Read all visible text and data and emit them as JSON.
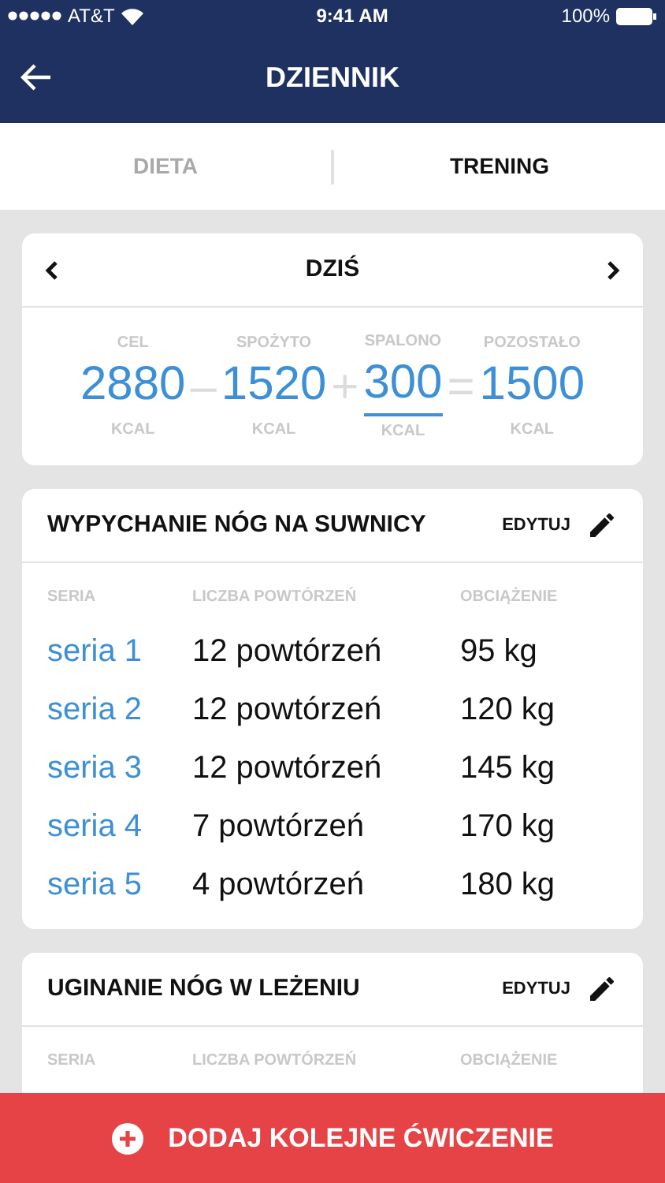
{
  "status_bar": {
    "carrier": "AT&T",
    "time": "9:41 AM",
    "battery": "100%"
  },
  "header": {
    "title": "DZIENNIK"
  },
  "tabs": [
    {
      "label": "DIETA",
      "selected": false
    },
    {
      "label": "TRENING",
      "selected": true
    }
  ],
  "day": {
    "label": "DZIŚ"
  },
  "summary": [
    {
      "kind": "value",
      "label": "CEL",
      "value": "2880",
      "unit": "KCAL",
      "editable": false
    },
    {
      "kind": "operator",
      "symbol": "–"
    },
    {
      "kind": "value",
      "label": "SPOŻYTO",
      "value": "1520",
      "unit": "KCAL",
      "editable": false
    },
    {
      "kind": "operator",
      "symbol": "+"
    },
    {
      "kind": "value",
      "label": "SPALONO",
      "value": "300",
      "unit": "KCAL",
      "editable": true
    },
    {
      "kind": "operator",
      "symbol": "="
    },
    {
      "kind": "value",
      "label": "POZOSTAŁO",
      "value": "1500",
      "unit": "KCAL",
      "editable": false
    }
  ],
  "exercises": [
    {
      "title": "WYPYCHANIE NÓG NA SUWNICY",
      "edit": "EDYTUJ",
      "columns": [
        "SERIA",
        "LICZBA POWTÓRZEŃ",
        "OBCIĄŻENIE"
      ],
      "rows": [
        {
          "set": "seria 1",
          "reps": "12 powtórzeń",
          "load": "95 kg"
        },
        {
          "set": "seria 2",
          "reps": "12 powtórzeń",
          "load": "120 kg"
        },
        {
          "set": "seria 3",
          "reps": "12 powtórzeń",
          "load": "145 kg"
        },
        {
          "set": "seria 4",
          "reps": "7 powtórzeń",
          "load": "170 kg"
        },
        {
          "set": "seria 5",
          "reps": "4 powtórzeń",
          "load": "180 kg"
        }
      ]
    },
    {
      "title": "UGINANIE NÓG W LEŻENIU",
      "edit": "EDYTUJ",
      "columns": [
        "SERIA",
        "LICZBA POWTÓRZEŃ",
        "OBCIĄŻENIE"
      ]
    }
  ],
  "add_button": {
    "label": "DODAJ KOLEJNE ĆWICZENIE"
  }
}
